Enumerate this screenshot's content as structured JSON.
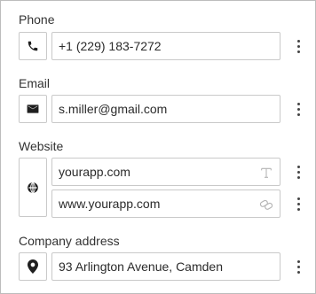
{
  "phone": {
    "label": "Phone",
    "value": "+1 (229) 183-7272",
    "icon": "phone-icon"
  },
  "email": {
    "label": "Email",
    "value": "s.miller@gmail.com",
    "icon": "mail-icon"
  },
  "website": {
    "label": "Website",
    "icon": "globe-icon",
    "entries": [
      {
        "value": "yourapp.com",
        "trailing_icon": "text-format-icon"
      },
      {
        "value": "www.yourapp.com",
        "trailing_icon": "link-icon"
      }
    ]
  },
  "company_address": {
    "label": "Company address",
    "value": "93 Arlington Avenue, Camden",
    "icon": "location-pin-icon"
  },
  "colors": {
    "border": "#c9c9c9",
    "text": "#2b2b2b",
    "icon": "#1f1f1f",
    "muted_icon": "#b5b5b5"
  }
}
